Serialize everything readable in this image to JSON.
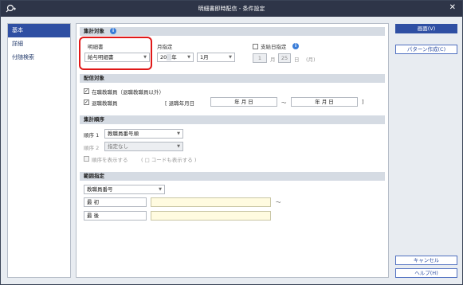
{
  "window": {
    "title": "明細書即時配信 - 条件設定",
    "close": "✕"
  },
  "nav": [
    {
      "label": "基本",
      "active": true
    },
    {
      "label": "詳細",
      "active": false
    },
    {
      "label": "付随検索",
      "active": false
    }
  ],
  "aggregate": {
    "section": "集計対象",
    "doc_label": "明細書",
    "doc_value": "給与明細書",
    "month_label": "月指定",
    "year_value": "20",
    "year_unit": "年",
    "month_value": "1月",
    "payday_label": "支給日指定",
    "pay_month": "1",
    "pay_month_unit": "月",
    "pay_day": "25",
    "pay_day_unit": "日",
    "pay_paren": "(月)"
  },
  "delivery": {
    "section": "配信対象",
    "opt1": "在職教職員（退職教職員以外）",
    "opt2": "退職教職員",
    "retire_label": "[ 退職年月日",
    "date_from": "年  月  日",
    "tilde": "〜",
    "date_to": "年  月  日",
    "close_bracket": "]"
  },
  "order": {
    "section": "集計順序",
    "o1_label": "順序 1",
    "o1_value": "教職員番号順",
    "o2_label": "順序 2",
    "o2_value": "指定なし",
    "show_order": "順序を表示する",
    "show_code": "( □ コードも表示する )"
  },
  "range": {
    "section": "範囲指定",
    "field": "教職員番号",
    "first": "最 初",
    "last": "最 後",
    "tilde": "〜"
  },
  "buttons": {
    "print": "画面(V)",
    "pattern": "パターン作成(C)",
    "cancel": "キャンセル",
    "help": "ヘルプ(H)"
  }
}
